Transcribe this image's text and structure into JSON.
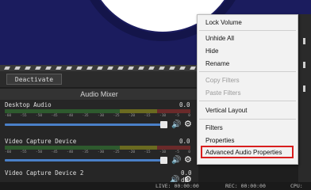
{
  "toolbar": {
    "deactivate_label": "Deactivate"
  },
  "mixer": {
    "title": "Audio Mixer",
    "scale_ticks": [
      "-60",
      "-55",
      "-50",
      "-45",
      "-40",
      "-35",
      "-30",
      "-25",
      "-20",
      "-15",
      "-10",
      "-5",
      "0"
    ],
    "channels": [
      {
        "name": "Desktop Audio",
        "level": "0.0"
      },
      {
        "name": "Video Capture Device",
        "level": "0.0"
      },
      {
        "name": "Video Capture Device 2",
        "level": "0.0 dB"
      }
    ]
  },
  "context_menu": {
    "items": [
      {
        "label": "Lock Volume",
        "disabled": false
      },
      {
        "label": "Unhide All",
        "disabled": false
      },
      {
        "label": "Hide",
        "disabled": false
      },
      {
        "label": "Rename",
        "disabled": false
      },
      {
        "label": "Copy Filters",
        "disabled": true
      },
      {
        "label": "Paste Filters",
        "disabled": true
      },
      {
        "label": "Vertical Layout",
        "disabled": false
      },
      {
        "label": "Filters",
        "disabled": false
      },
      {
        "label": "Properties",
        "disabled": false
      },
      {
        "label": "Advanced Audio Properties",
        "disabled": false,
        "highlighted": true
      }
    ],
    "highlight_color": "#d81e1e"
  },
  "statusbar": {
    "live": "LIVE: 00:00:00",
    "rec": "REC: 00:00:00",
    "cpu": "CPU: "
  },
  "colors": {
    "accent": "#4a80c8",
    "preview_bg": "#1b1c5e"
  },
  "icons": {
    "speaker": "speaker-icon",
    "gear": "gear-icon"
  }
}
